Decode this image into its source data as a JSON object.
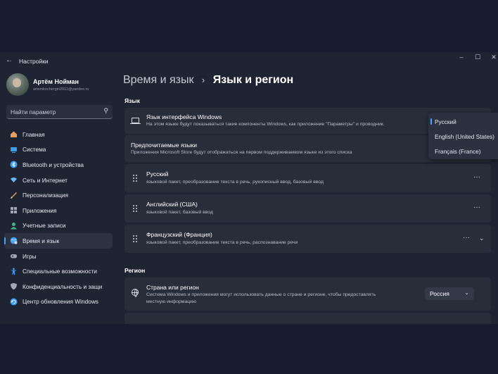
{
  "window": {
    "title": "Настройки",
    "controls": {
      "minimize": "–",
      "maximize": "☐",
      "close": "✕"
    }
  },
  "profile": {
    "name": "Артём Нойман",
    "email": "artemkochergin2011@yandex.ru"
  },
  "search": {
    "placeholder": "Найти параметр",
    "icon": "search-icon"
  },
  "sidebar": {
    "items": [
      {
        "label": "Главная",
        "icon": "home-icon",
        "color": "#e8a15b"
      },
      {
        "label": "Система",
        "icon": "system-icon",
        "color": "#3b9cf0"
      },
      {
        "label": "Bluetooth и устройства",
        "icon": "bluetooth-icon",
        "color": "#3b9cf0"
      },
      {
        "label": "Сеть и Интернет",
        "icon": "network-icon",
        "color": "#6ab7f5"
      },
      {
        "label": "Персонализация",
        "icon": "brush-icon",
        "color": "#e8a15b"
      },
      {
        "label": "Приложения",
        "icon": "apps-icon",
        "color": "#a0a8b8"
      },
      {
        "label": "Учетные записи",
        "icon": "accounts-icon",
        "color": "#3fb58b"
      },
      {
        "label": "Время и язык",
        "icon": "time-language-icon",
        "color": "#4aa4ff"
      },
      {
        "label": "Игры",
        "icon": "games-icon",
        "color": "#a0a8b8"
      },
      {
        "label": "Специальные возможности",
        "icon": "accessibility-icon",
        "color": "#4aa4ff"
      },
      {
        "label": "Конфиденциальность и защи",
        "icon": "shield-icon",
        "color": "#a0a8b8"
      },
      {
        "label": "Центр обновления Windows",
        "icon": "update-icon",
        "color": "#3b9cf0"
      }
    ],
    "active_index": 7
  },
  "breadcrumb": {
    "parent": "Время и язык",
    "separator": "›",
    "current": "Язык и регион"
  },
  "language_section": {
    "title": "Язык",
    "display_language": {
      "title": "Язык интерфейса Windows",
      "desc": "На этом языке будут показываться такие компоненты Windows, как приложение \"Параметры\" и проводник."
    },
    "preferred": {
      "title": "Предпочитаемые языки",
      "desc": "Приложения Microsoft Store будут отображаться на первом поддерживаемом языке из этого списка"
    },
    "languages": [
      {
        "name": "Русский",
        "features": "языковой пакет, преобразование текста в речь, рукописный ввод, базовый ввод"
      },
      {
        "name": "Английский (США)",
        "features": "языковой пакет, базовый ввод"
      },
      {
        "name": "Французский (Франция)",
        "features": "языковой пакет, преобразование текста в речь, распознавание речи"
      }
    ],
    "dropdown_options": [
      "Русский",
      "English (United States)",
      "Français (France)"
    ],
    "dropdown_selected_index": 0
  },
  "region_section": {
    "title": "Регион",
    "country": {
      "title": "Страна или регион",
      "desc_line1": "Система Windows и приложения могут использовать данные о стране и регионе, чтобы предоставлять",
      "desc_line2": "местную информацию",
      "value": "Россия"
    }
  },
  "colors": {
    "accent": "#4aa4ff",
    "window_bg": "#1f2432",
    "card_bg": "#282d3a",
    "desktop_bg": "#181c2e"
  }
}
